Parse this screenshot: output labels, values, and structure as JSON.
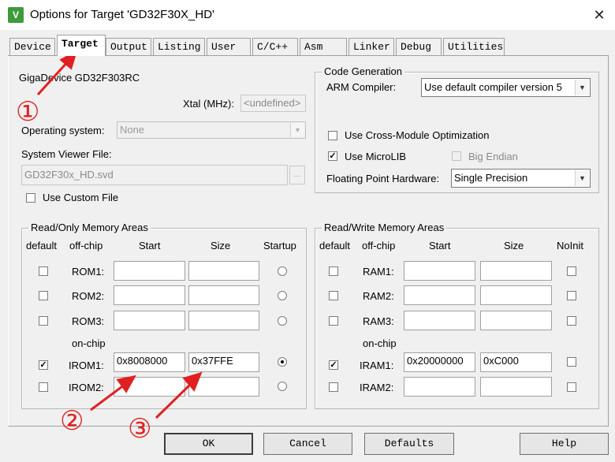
{
  "window": {
    "title": "Options for Target 'GD32F30X_HD'",
    "icon": "keil-app-icon",
    "close_glyph": "✕"
  },
  "tabs": [
    {
      "label": "Device",
      "active": false
    },
    {
      "label": "Target",
      "active": true
    },
    {
      "label": "Output",
      "active": false
    },
    {
      "label": "Listing",
      "active": false
    },
    {
      "label": "User",
      "active": false
    },
    {
      "label": "C/C++",
      "active": false
    },
    {
      "label": "Asm",
      "active": false
    },
    {
      "label": "Linker",
      "active": false
    },
    {
      "label": "Debug",
      "active": false
    },
    {
      "label": "Utilities",
      "active": false
    }
  ],
  "device": {
    "name": "GigaDevice GD32F303RC",
    "xtal_label": "Xtal (MHz):",
    "xtal_value": "<undefined>",
    "os_label": "Operating system:",
    "os_value": "None",
    "svd_label": "System Viewer File:",
    "svd_value": "GD32F30x_HD.svd",
    "svd_browse": "...",
    "custom_file_label": "Use Custom File",
    "custom_file_checked": false
  },
  "code_generation": {
    "title": "Code Generation",
    "arm_compiler_label": "ARM Compiler:",
    "arm_compiler_value": "Use default compiler version 5",
    "cross_module_label": "Use Cross-Module Optimization",
    "cross_module_checked": false,
    "microlib_label": "Use MicroLIB",
    "microlib_checked": true,
    "big_endian_label": "Big Endian",
    "big_endian_checked": false,
    "fpu_label": "Floating Point Hardware:",
    "fpu_value": "Single Precision"
  },
  "rom": {
    "title": "Read/Only Memory Areas",
    "headers": {
      "default": "default",
      "offchip": "off-chip",
      "start": "Start",
      "size": "Size",
      "startup": "Startup"
    },
    "onchip_label": "on-chip",
    "rows": [
      {
        "name": "ROM1:",
        "default": false,
        "start": "",
        "size": "",
        "startup": false
      },
      {
        "name": "ROM2:",
        "default": false,
        "start": "",
        "size": "",
        "startup": false
      },
      {
        "name": "ROM3:",
        "default": false,
        "start": "",
        "size": "",
        "startup": false
      },
      {
        "name": "IROM1:",
        "default": true,
        "start": "0x8008000",
        "size": "0x37FFE",
        "startup": true
      },
      {
        "name": "IROM2:",
        "default": false,
        "start": "",
        "size": "",
        "startup": false
      }
    ]
  },
  "ram": {
    "title": "Read/Write Memory Areas",
    "headers": {
      "default": "default",
      "offchip": "off-chip",
      "start": "Start",
      "size": "Size",
      "noinit": "NoInit"
    },
    "onchip_label": "on-chip",
    "rows": [
      {
        "name": "RAM1:",
        "default": false,
        "start": "",
        "size": "",
        "noinit": false
      },
      {
        "name": "RAM2:",
        "default": false,
        "start": "",
        "size": "",
        "noinit": false
      },
      {
        "name": "RAM3:",
        "default": false,
        "start": "",
        "size": "",
        "noinit": false
      },
      {
        "name": "IRAM1:",
        "default": true,
        "start": "0x20000000",
        "size": "0xC000",
        "noinit": false
      },
      {
        "name": "IRAM2:",
        "default": false,
        "start": "",
        "size": "",
        "noinit": false
      }
    ]
  },
  "buttons": {
    "ok": "OK",
    "cancel": "Cancel",
    "defaults": "Defaults",
    "help": "Help"
  },
  "annotations": {
    "one": "①",
    "two": "②",
    "three": "③",
    "color": "#e02020"
  },
  "colors": {
    "panel": "#f0f0f0",
    "titlebar": "#ffffff",
    "annotation": "#e02020"
  }
}
